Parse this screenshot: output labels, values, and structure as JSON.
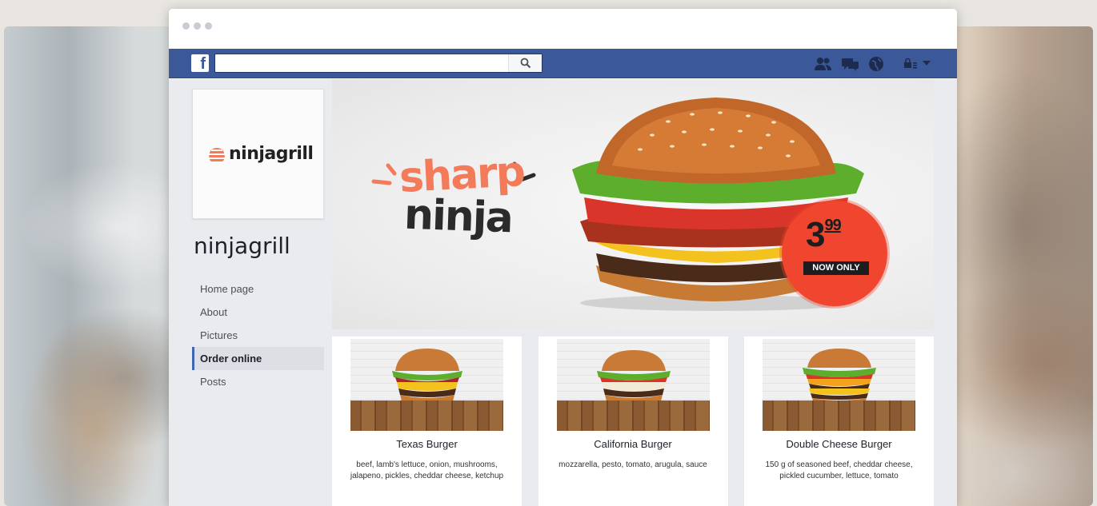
{
  "facebook": {
    "logo_letter": "f",
    "search": {
      "value": "",
      "placeholder": ""
    }
  },
  "page": {
    "logo_text": "ninjagrill",
    "name": "ninjagrill",
    "nav": [
      {
        "label": "Home page",
        "active": false
      },
      {
        "label": "About",
        "active": false
      },
      {
        "label": "Pictures",
        "active": false
      },
      {
        "label": "Order online",
        "active": true
      },
      {
        "label": "Posts",
        "active": false
      }
    ]
  },
  "cover": {
    "slogan_line1": "sharp",
    "slogan_line2": "ninja",
    "price_main": "3",
    "price_cents": "99",
    "price_note": "NOW ONLY"
  },
  "products": [
    {
      "title": "Texas Burger",
      "description": "beef, lamb's lettuce, onion, mushrooms, jalapeno, pickles, cheddar cheese, ketchup"
    },
    {
      "title": "California Burger",
      "description": "mozzarella, pesto, tomato, arugula, sauce"
    },
    {
      "title": "Double Cheese Burger",
      "description": "150 g of seasoned beef, cheddar cheese, pickled cucumber, lettuce, tomato"
    }
  ],
  "colors": {
    "facebook_blue": "#3b5998",
    "brand_orange": "#f47b5a",
    "badge_red": "#f0462f"
  },
  "icons": [
    "search-icon",
    "friends-icon",
    "messages-icon",
    "globe-icon",
    "lock-icon",
    "dropdown-icon"
  ]
}
